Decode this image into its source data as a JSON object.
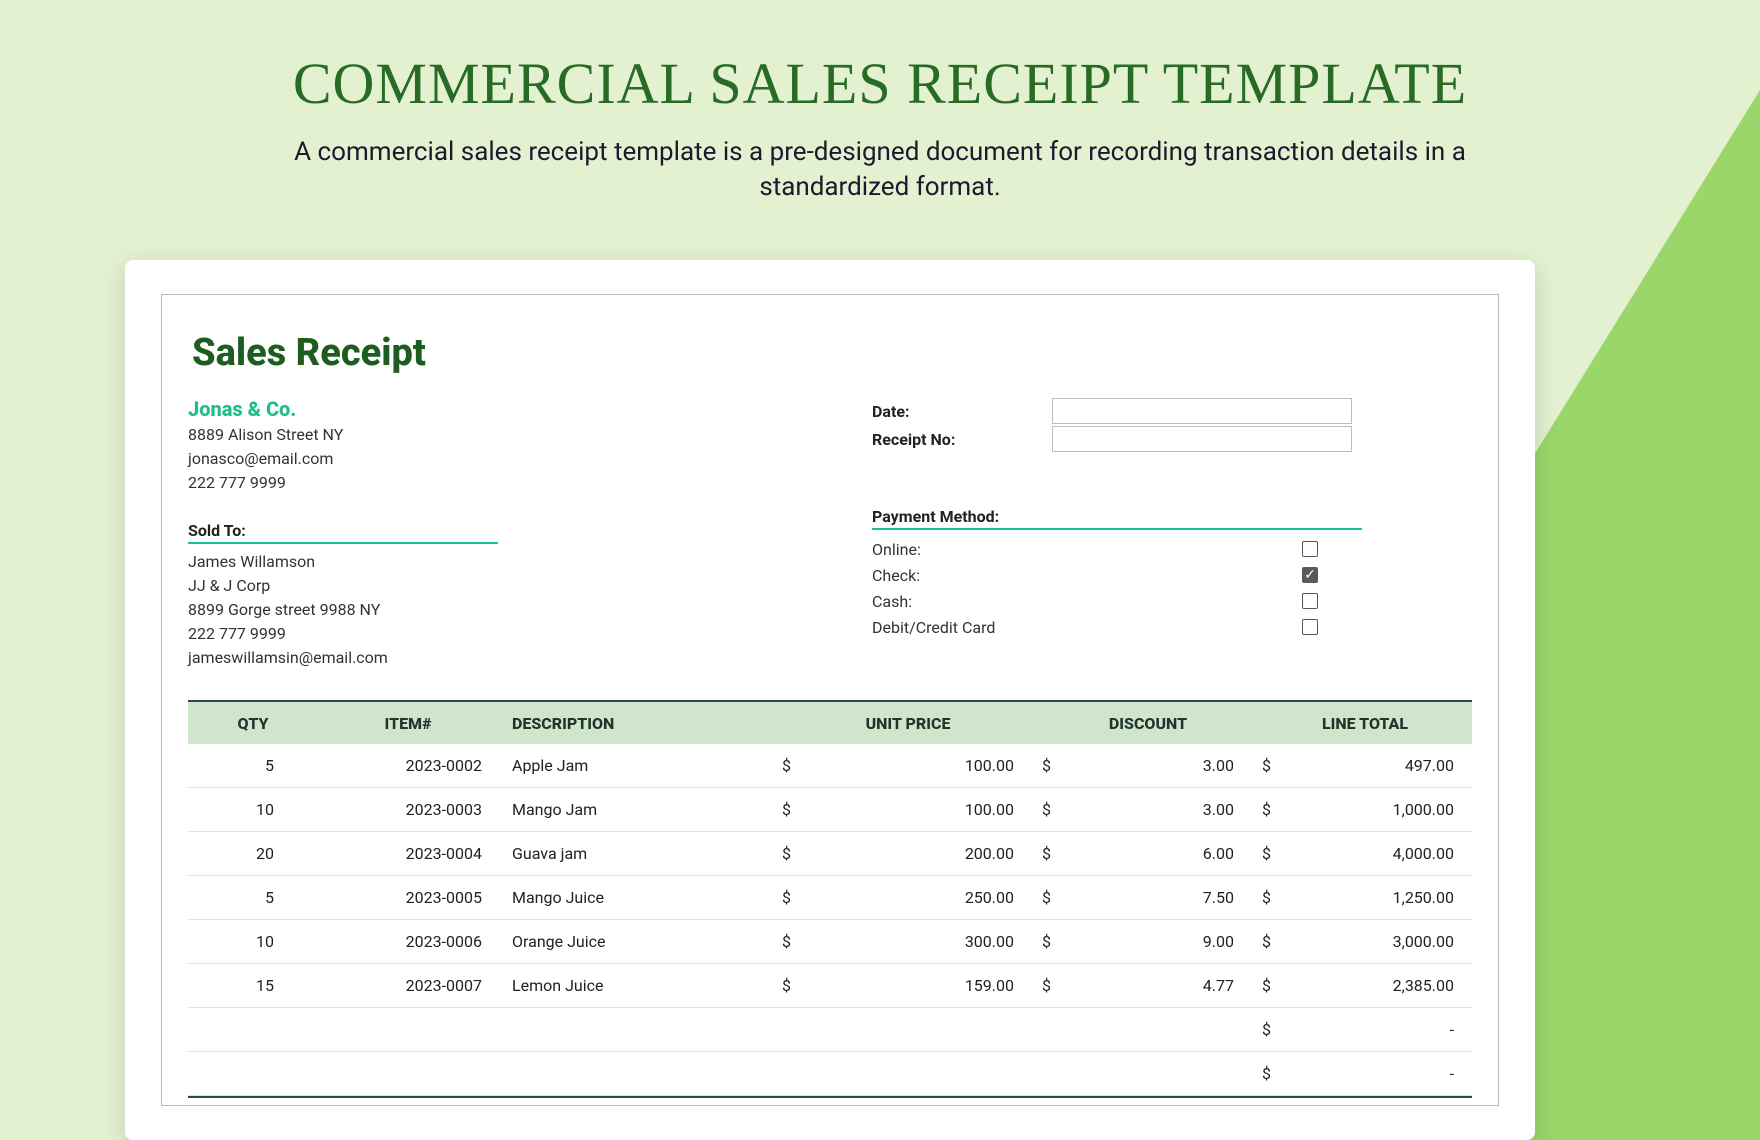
{
  "page": {
    "title": "COMMERCIAL SALES RECEIPT TEMPLATE",
    "subtitle": "A commercial sales receipt template is a pre-designed document for recording transaction details in a standardized format."
  },
  "doc_title": "Sales Receipt",
  "company": {
    "name": "Jonas & Co.",
    "address": "8889 Alison Street NY",
    "email": "jonasco@email.com",
    "phone": "222 777 9999"
  },
  "meta": {
    "date_label": "Date:",
    "receipt_no_label": "Receipt No:",
    "date_value": "",
    "receipt_no_value": ""
  },
  "sold_to": {
    "header": "Sold To:",
    "name": "James Willamson",
    "org": "JJ & J Corp",
    "address": "8899 Gorge street 9988 NY",
    "phone": "222 777 9999",
    "email": "jameswillamsin@email.com"
  },
  "payment_method": {
    "header": "Payment Method:",
    "options": [
      {
        "label": "Online:",
        "checked": false
      },
      {
        "label": "Check:",
        "checked": true
      },
      {
        "label": "Cash:",
        "checked": false
      },
      {
        "label": "Debit/Credit Card",
        "checked": false
      }
    ]
  },
  "table": {
    "headers": {
      "qty": "QTY",
      "item": "ITEM#",
      "desc": "DESCRIPTION",
      "unit": "UNIT PRICE",
      "disc": "DISCOUNT",
      "total": "LINE TOTAL"
    },
    "rows": [
      {
        "qty": "5",
        "item": "2023-0002",
        "desc": "Apple Jam",
        "unit": "100.00",
        "disc": "3.00",
        "total": "497.00"
      },
      {
        "qty": "10",
        "item": "2023-0003",
        "desc": "Mango Jam",
        "unit": "100.00",
        "disc": "3.00",
        "total": "1,000.00"
      },
      {
        "qty": "20",
        "item": "2023-0004",
        "desc": "Guava jam",
        "unit": "200.00",
        "disc": "6.00",
        "total": "4,000.00"
      },
      {
        "qty": "5",
        "item": "2023-0005",
        "desc": "Mango Juice",
        "unit": "250.00",
        "disc": "7.50",
        "total": "1,250.00"
      },
      {
        "qty": "10",
        "item": "2023-0006",
        "desc": "Orange Juice",
        "unit": "300.00",
        "disc": "9.00",
        "total": "3,000.00"
      },
      {
        "qty": "15",
        "item": "2023-0007",
        "desc": "Lemon Juice",
        "unit": "159.00",
        "disc": "4.77",
        "total": "2,385.00"
      },
      {
        "qty": "",
        "item": "",
        "desc": "",
        "unit": "",
        "disc": "",
        "total": "-"
      },
      {
        "qty": "",
        "item": "",
        "desc": "",
        "unit": "",
        "disc": "",
        "total": "-"
      }
    ],
    "currency_symbol": "$"
  }
}
